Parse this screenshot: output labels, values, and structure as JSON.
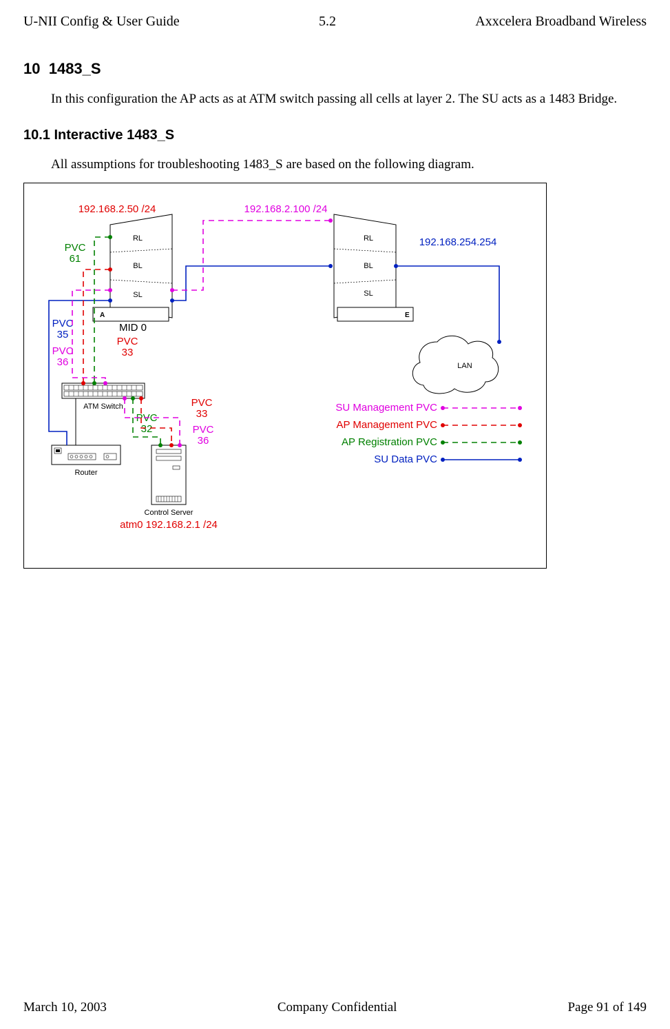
{
  "header": {
    "left": "U-NII Config & User Guide",
    "center": "5.2",
    "right": "Axxcelera Broadband Wireless"
  },
  "title_num": "10",
  "title_txt": "1483_S",
  "para1": "In this configuration the AP acts as at ATM switch passing all cells at layer 2. The SU acts as a 1483 Bridge.",
  "sec_num": "10.1",
  "sec_txt": "Interactive 1483_S",
  "para2": "All assumptions for troubleshooting 1483_S are based on the following diagram.",
  "fig": {
    "ap": {
      "rl": "RL",
      "bl": "BL",
      "sl": "SL",
      "letter": "A",
      "mid": "MID 0"
    },
    "su": {
      "rl": "RL",
      "bl": "BL",
      "sl": "SL",
      "letter": "E"
    },
    "ip_ap": "192.168.2.50 /24",
    "ip_su": "192.168.2.100 /24",
    "ip_lan": "192.168.254.254",
    "pvc61": "PVC 61",
    "pvc35": "PVC 35",
    "pvc36a": "PVC 36",
    "pvc33a": "PVC 33",
    "pvc32": "PVC 32",
    "pvc33b": "PVC 33",
    "pvc36b": "PVC 36",
    "atm": "ATM Switch",
    "router": "Router",
    "ctrl": "Control Server",
    "ctrl_ip": "atm0 192.168.2.1 /24",
    "lan": "LAN",
    "legend": {
      "su_mgmt": "SU Management PVC",
      "ap_mgmt": "AP Management PVC",
      "ap_reg": "AP Registration PVC",
      "su_data": "SU Data PVC"
    }
  },
  "footer": {
    "left": "March 10, 2003",
    "center": "Company Confidential",
    "right": "Page 91 of 149"
  },
  "colors": {
    "red": "#e00000",
    "green": "#008000",
    "blue": "#0020c0",
    "magenta": "#e000e0",
    "black": "#000000"
  }
}
